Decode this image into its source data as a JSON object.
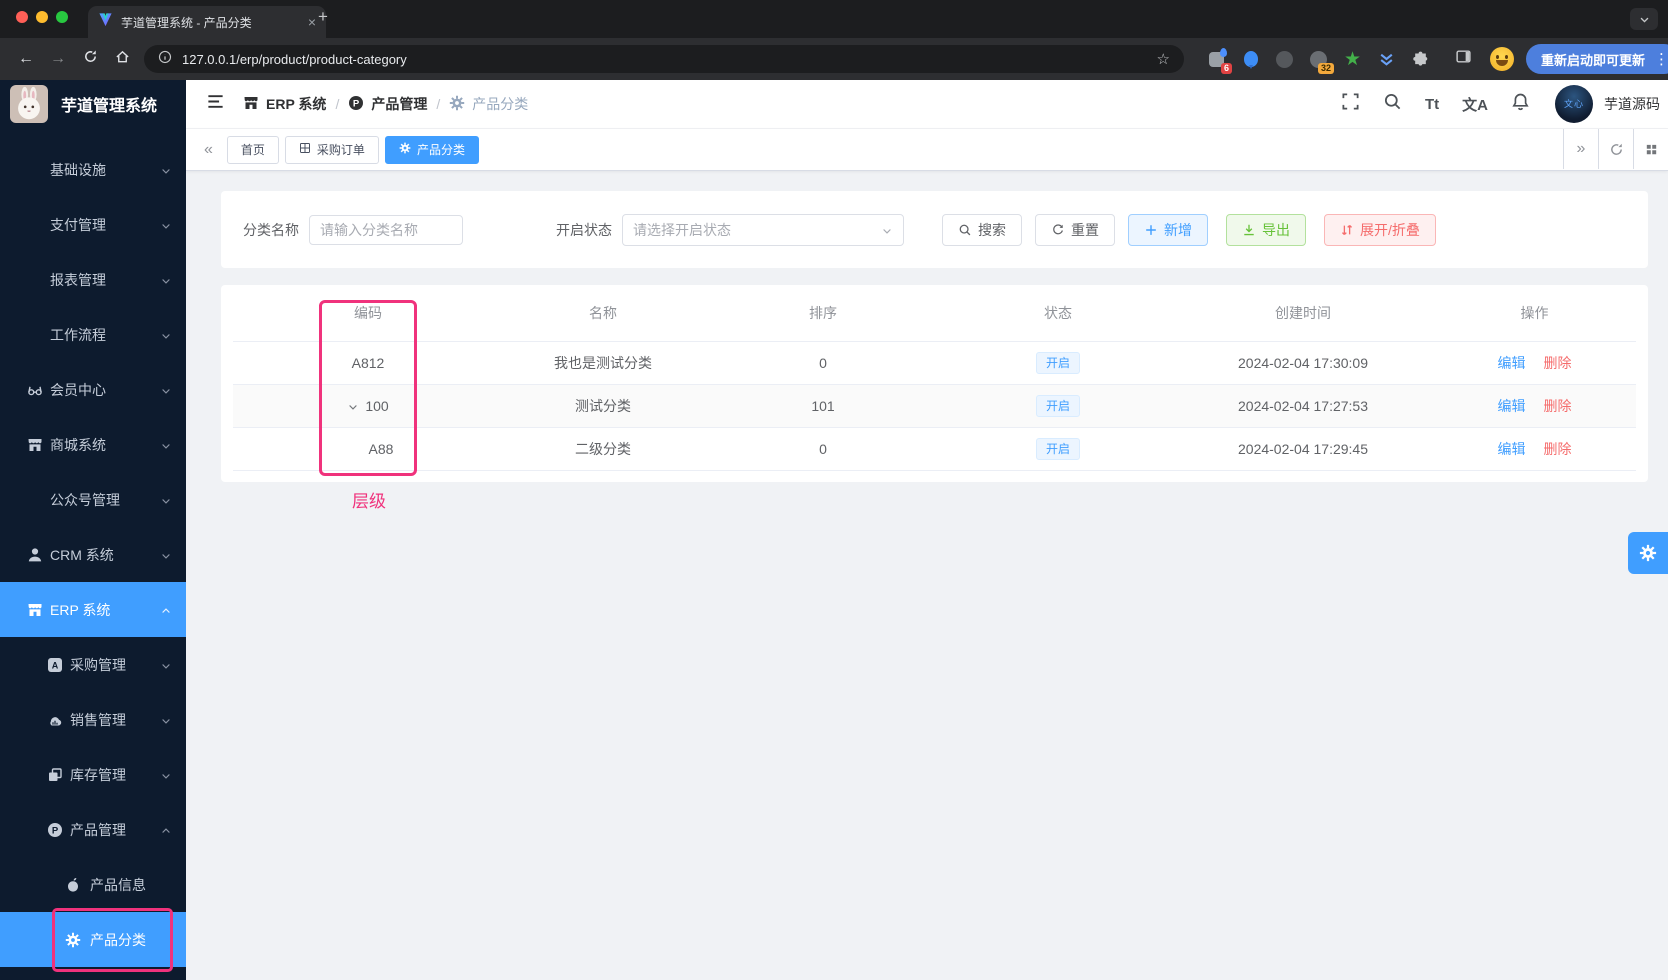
{
  "browser": {
    "tab_title": "芋道管理系统 - 产品分类",
    "url": "127.0.0.1/erp/product/product-category",
    "update_button": "重新启动即可更新",
    "ext_badge_first": "6",
    "ext_badge_second": "32"
  },
  "sidebar": {
    "logo_title": "芋道管理系统",
    "items": [
      {
        "label": "基础设施",
        "icon": null,
        "level": 0,
        "chevron": "down",
        "active": false
      },
      {
        "label": "支付管理",
        "icon": null,
        "level": 0,
        "chevron": "down",
        "active": false
      },
      {
        "label": "报表管理",
        "icon": null,
        "level": 0,
        "chevron": "down",
        "active": false
      },
      {
        "label": "工作流程",
        "icon": null,
        "level": 0,
        "chevron": "down",
        "active": false
      },
      {
        "label": "会员中心",
        "icon": "glasses",
        "level": 0,
        "chevron": "down",
        "active": false
      },
      {
        "label": "商城系统",
        "icon": "shop",
        "level": 0,
        "chevron": "down",
        "active": false
      },
      {
        "label": "公众号管理",
        "icon": null,
        "level": 0,
        "chevron": "down",
        "active": false
      },
      {
        "label": "CRM 系统",
        "icon": "user",
        "level": 0,
        "chevron": "down",
        "active": false
      },
      {
        "label": "ERP 系统",
        "icon": "shop",
        "level": 0,
        "chevron": "up",
        "active": true
      },
      {
        "label": "采购管理",
        "icon": "a-square",
        "level": 1,
        "chevron": "down",
        "active": false
      },
      {
        "label": "销售管理",
        "icon": "sales-chart",
        "level": 1,
        "chevron": "down",
        "active": false
      },
      {
        "label": "库存管理",
        "icon": "stock-copy",
        "level": 1,
        "chevron": "down",
        "active": false
      },
      {
        "label": "产品管理",
        "icon": "p-circle",
        "level": 1,
        "chevron": "up",
        "active": false
      },
      {
        "label": "产品信息",
        "icon": "apple",
        "level": 2,
        "chevron": null,
        "active": false
      },
      {
        "label": "产品分类",
        "icon": "gear",
        "level": 2,
        "chevron": null,
        "active": true,
        "annotated": true
      }
    ]
  },
  "header": {
    "breadcrumb": [
      {
        "icon": "shop",
        "label": "ERP 系统"
      },
      {
        "icon": "p-circle",
        "label": "产品管理"
      },
      {
        "icon": "gear",
        "label": "产品分类"
      }
    ],
    "font_size_icon": "Tt",
    "locale_icon": "文A",
    "avatar_label": "文心",
    "username": "芋道源码"
  },
  "tags_bar": {
    "tabs": [
      {
        "label": "首页",
        "icon": null,
        "active": false
      },
      {
        "label": "采购订单",
        "icon": "grid",
        "active": false
      },
      {
        "label": "产品分类",
        "icon": "gear",
        "active": true
      }
    ]
  },
  "filter": {
    "name_label": "分类名称",
    "name_placeholder": "请输入分类名称",
    "status_label": "开启状态",
    "status_placeholder": "请选择开启状态",
    "search_label": "搜索",
    "reset_label": "重置",
    "add_label": "新增",
    "export_label": "导出",
    "toggle_label": "展开/折叠"
  },
  "table": {
    "columns": [
      "编码",
      "名称",
      "排序",
      "状态",
      "创建时间",
      "操作"
    ],
    "rows": [
      {
        "code": "A812",
        "name": "我也是测试分类",
        "sort": "0",
        "status": "开启",
        "created": "2024-02-04 17:30:09",
        "expanded": false,
        "child": false,
        "striped": false
      },
      {
        "code": "100",
        "name": "测试分类",
        "sort": "101",
        "status": "开启",
        "created": "2024-02-04 17:27:53",
        "expanded": true,
        "child": false,
        "striped": true
      },
      {
        "code": "A88",
        "name": "二级分类",
        "sort": "0",
        "status": "开启",
        "created": "2024-02-04 17:29:45",
        "expanded": false,
        "child": true,
        "striped": false
      }
    ],
    "edit_label": "编辑",
    "delete_label": "删除"
  },
  "annotation": {
    "hierarchy_label": "层级",
    "color": "#f0327c"
  },
  "colors": {
    "primary": "#409eff",
    "success": "#67c23a",
    "danger": "#f56c6c",
    "sidebar_bg": "#0d1b2e"
  }
}
